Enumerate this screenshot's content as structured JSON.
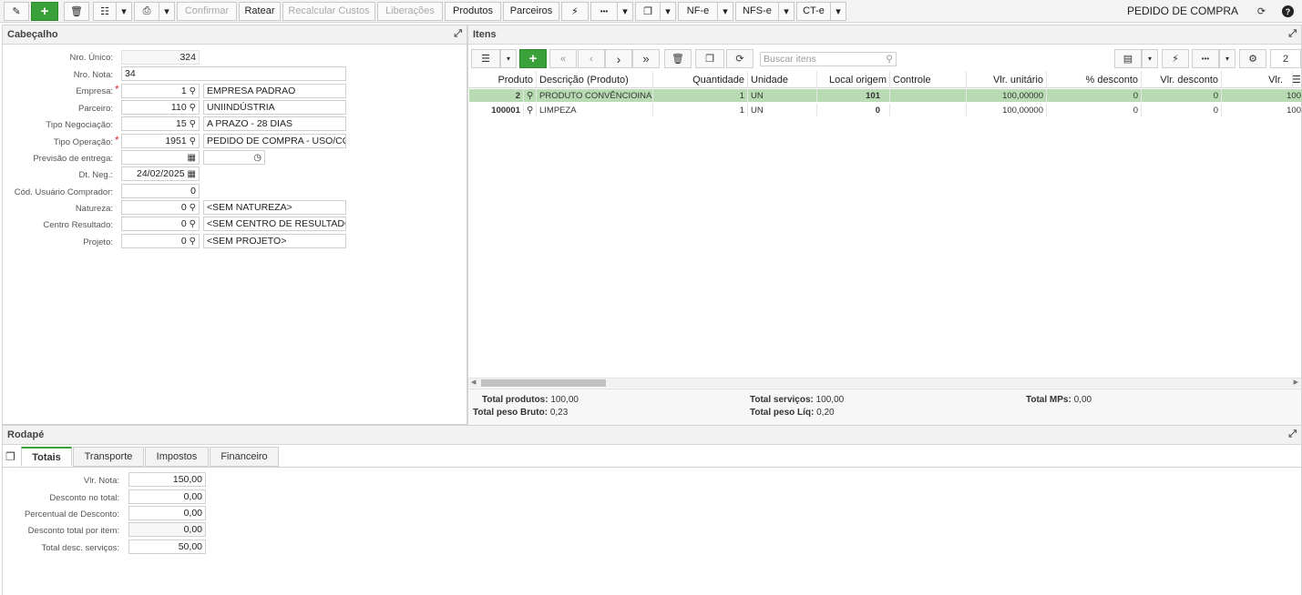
{
  "toolbar": {
    "confirmar": "Confirmar",
    "ratear": "Ratear",
    "recalcular": "Recalcular Custos",
    "liberacoes": "Liberações",
    "produtos": "Produtos",
    "parceiros": "Parceiros",
    "nfe": "NF-e",
    "nfse": "NFS-e",
    "cte": "CT-e",
    "more": "•••",
    "title": "PEDIDO DE COMPRA"
  },
  "cabecalho": {
    "title": "Cabeçalho",
    "fields": {
      "nro_unico": {
        "label": "Nro. Único:",
        "value": "324"
      },
      "nro_nota": {
        "label": "Nro. Nota:",
        "value": "34"
      },
      "empresa": {
        "label": "Empresa:",
        "code": "1",
        "desc": "EMPRESA PADRAO"
      },
      "parceiro": {
        "label": "Parceiro:",
        "code": "110",
        "desc": "UNIINDÚSTRIA"
      },
      "tipo_negociacao": {
        "label": "Tipo Negociação:",
        "code": "15",
        "desc": "A PRAZO - 28 DIAS"
      },
      "tipo_operacao": {
        "label": "Tipo Operação:",
        "code": "1951",
        "desc": "PEDIDO DE COMPRA - USO/CONSUMO"
      },
      "previsao": {
        "label": "Previsão de entrega:",
        "value": ""
      },
      "dt_neg": {
        "label": "Dt. Neg.:",
        "value": "24/02/2025"
      },
      "usuario_comprador": {
        "label": "Cód. Usuário Comprador:",
        "value": "0"
      },
      "natureza": {
        "label": "Natureza:",
        "code": "0",
        "desc": "<SEM NATUREZA>"
      },
      "centro_resultado": {
        "label": "Centro Resultado:",
        "code": "0",
        "desc": "<SEM CENTRO DE RESULTADO>"
      },
      "projeto": {
        "label": "Projeto:",
        "code": "0",
        "desc": "<SEM PROJETO>"
      }
    }
  },
  "itens": {
    "title": "Itens",
    "search_placeholder": "Buscar itens",
    "page": "2",
    "columns": [
      "Produto",
      "Descrição (Produto)",
      "Quantidade",
      "Unidade",
      "Local origem",
      "Controle",
      "Vlr. unitário",
      "% desconto",
      "Vlr. desconto",
      "Vlr."
    ],
    "rows": [
      {
        "produto": "2",
        "descricao": "PRODUTO CONVÊNCIOINAL",
        "quantidade": "1",
        "unidade": "UN",
        "local": "101",
        "controle": "",
        "vlr_unit": "100,00000",
        "pct_desc": "0",
        "vlr_desc": "0",
        "vlr": "100"
      },
      {
        "produto": "100001",
        "descricao": "LIMPEZA",
        "quantidade": "1",
        "unidade": "UN",
        "local": "0",
        "controle": "",
        "vlr_unit": "100,00000",
        "pct_desc": "0",
        "vlr_desc": "0",
        "vlr": "100"
      }
    ],
    "summary": {
      "total_produtos_label": "Total produtos:",
      "total_produtos": "100,00",
      "total_peso_bruto_label": "Total peso Bruto:",
      "total_peso_bruto": "0,23",
      "total_servicos_label": "Total serviços:",
      "total_servicos": "100,00",
      "total_peso_liq_label": "Total peso Líq:",
      "total_peso_liq": "0,20",
      "total_mps_label": "Total MPs:",
      "total_mps": "0,00"
    }
  },
  "rodape": {
    "title": "Rodapé",
    "tabs": [
      "Totais",
      "Transporte",
      "Impostos",
      "Financeiro"
    ],
    "fields": [
      {
        "label": "Vlr. Nota:",
        "value": "150,00"
      },
      {
        "label": "Desconto no total:",
        "value": "0,00"
      },
      {
        "label": "Percentual de Desconto:",
        "value": "0,00"
      },
      {
        "label": "Desconto total por item:",
        "value": "0,00"
      },
      {
        "label": "Total desc. serviços:",
        "value": "50,00"
      }
    ]
  }
}
